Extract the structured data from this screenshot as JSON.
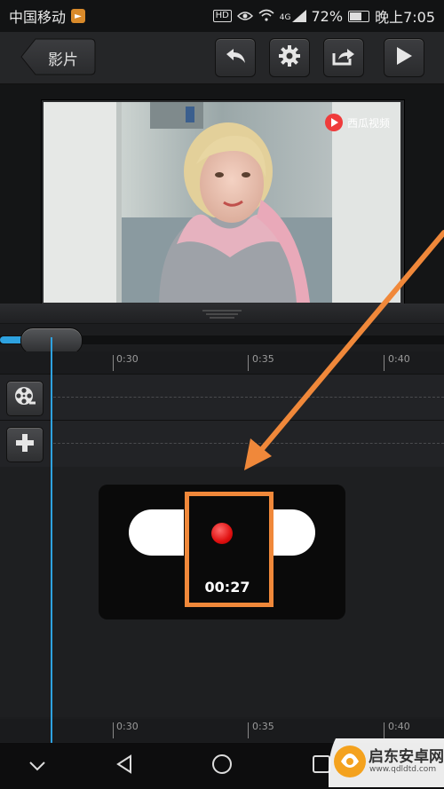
{
  "status_bar": {
    "carrier": "中国移动",
    "hd": "HD",
    "signal": "4G",
    "battery": "72%",
    "battery_level": 0.72,
    "time": "晚上7:05"
  },
  "toolbar": {
    "back_label": "影片"
  },
  "video": {
    "logo_text": "西瓜视频"
  },
  "ruler": {
    "ticks": [
      "0:30",
      "0:35",
      "0:40"
    ]
  },
  "recorder": {
    "elapsed": "00:27"
  },
  "watermark": {
    "name": "启东安卓网",
    "url": "www.qdldtd.com"
  },
  "colors": {
    "accent": "#2ea2e0",
    "annotation": "#f0883a",
    "record": "#e01010"
  },
  "icons": [
    "undo-icon",
    "gear-icon",
    "share-icon",
    "play-icon",
    "film-reel-icon",
    "plus-icon",
    "back-nav-icon",
    "home-nav-icon",
    "recents-nav-icon"
  ]
}
